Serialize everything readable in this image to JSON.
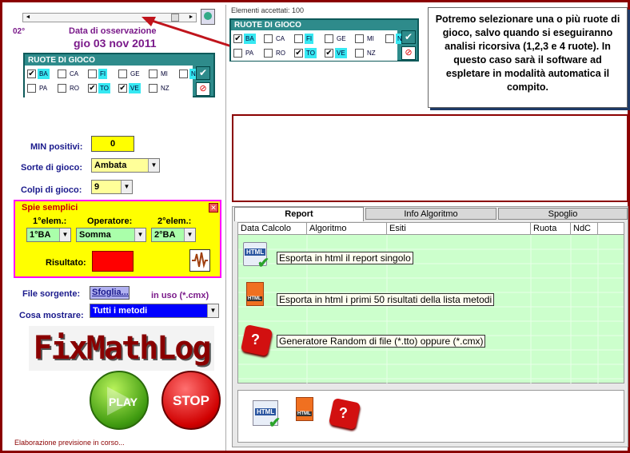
{
  "left": {
    "degree": "02°",
    "date_label": "Data di osservazione",
    "date_value": "gio 03 nov 2011",
    "ruote_title": "RUOTE DI GIOCO",
    "wheels": [
      {
        "label": "BA",
        "checked": true,
        "highlight": true
      },
      {
        "label": "CA",
        "checked": false,
        "highlight": false
      },
      {
        "label": "FI",
        "checked": false,
        "highlight": true
      },
      {
        "label": "GE",
        "checked": false,
        "highlight": false
      },
      {
        "label": "MI",
        "checked": false,
        "highlight": false
      },
      {
        "label": "NA",
        "checked": false,
        "highlight": true
      },
      {
        "label": "PA",
        "checked": false,
        "highlight": false
      },
      {
        "label": "RO",
        "checked": false,
        "highlight": false
      },
      {
        "label": "TO",
        "checked": true,
        "highlight": true
      },
      {
        "label": "VE",
        "checked": true,
        "highlight": true
      },
      {
        "label": "NZ",
        "checked": false,
        "highlight": false
      }
    ],
    "min_positivi_label": "MIN positivi:",
    "min_positivi_value": "0",
    "sorte_label": "Sorte di gioco:",
    "sorte_value": "Ambata",
    "colpi_label": "Colpi di gioco:",
    "colpi_value": "9",
    "spie_title": "Spie semplici",
    "elem1_label": "1°elem.:",
    "operatore_label": "Operatore:",
    "elem2_label": "2°elem.:",
    "elem1_value": "1°BA",
    "operatore_value": "Somma",
    "elem2_value": "2°BA",
    "risultato_label": "Risultato:",
    "file_label": "File sorgente:",
    "sfoglia_label": "Sfoglia...",
    "in_uso": "in uso (*.cmx)",
    "cosa_label": "Cosa mostrare:",
    "cosa_value": "Tutti i metodi",
    "logo_text": "FixMathLog",
    "play_label": "PLAY",
    "stop_label": "STOP",
    "status": "Elaborazione previsione in corso..."
  },
  "right": {
    "elementi": "Elementi accettati: 100",
    "ruote_title": "RUOTE DI GIOCO",
    "wheels": [
      {
        "label": "BA",
        "checked": true,
        "highlight": true
      },
      {
        "label": "CA",
        "checked": false,
        "highlight": false
      },
      {
        "label": "FI",
        "checked": false,
        "highlight": true
      },
      {
        "label": "GE",
        "checked": false,
        "highlight": false
      },
      {
        "label": "MI",
        "checked": false,
        "highlight": false
      },
      {
        "label": "NA",
        "checked": false,
        "highlight": true
      },
      {
        "label": "PA",
        "checked": false,
        "highlight": false
      },
      {
        "label": "RO",
        "checked": false,
        "highlight": false
      },
      {
        "label": "TO",
        "checked": true,
        "highlight": true
      },
      {
        "label": "VE",
        "checked": true,
        "highlight": true
      },
      {
        "label": "NZ",
        "checked": false,
        "highlight": false
      }
    ],
    "callout": "Potremo selezionare una o più ruote di gioco, salvo quando si eseguiranno analisi ricorsiva (1,2,3 e 4 ruote). In questo caso sarà il software ad espletare in modalità automatica il compito.",
    "tabs": [
      "Report",
      "Info Algoritmo",
      "Spoglio"
    ],
    "columns": [
      "Data Calcolo",
      "Algoritmo",
      "Esiti",
      "Ruota",
      "NdC"
    ],
    "tooltips": [
      "Esporta in html il report singolo",
      "Esporta in html i primi 50 risultati della lista metodi",
      "Generatore Random di file (*.tto) oppure (*.cmx)"
    ],
    "icon_html_text": "HTML"
  },
  "colors": {
    "frame": "#8b0000",
    "teal": "#2e8b8b",
    "cyan_highlight": "#36e8f2",
    "yellow": "#ffff00",
    "grid_green": "#ccffcc",
    "blue_select": "#0000ff"
  }
}
